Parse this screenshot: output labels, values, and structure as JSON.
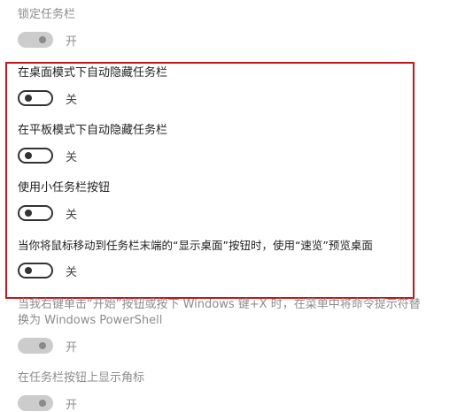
{
  "settings": [
    {
      "label": "锁定任务栏",
      "state": "开"
    },
    {
      "label": "在桌面模式下自动隐藏任务栏",
      "state": "关"
    },
    {
      "label": "在平板模式下自动隐藏任务栏",
      "state": "关"
    },
    {
      "label": "使用小任务栏按钮",
      "state": "关"
    },
    {
      "label": "当你将鼠标移动到任务栏末端的“显示桌面”按钮时，使用“速览”预览桌面",
      "state": "关"
    },
    {
      "label": "当我右键单击“开始”按钮或按下 Windows 键+X 时，在菜单中将命令提示符替换为 Windows PowerShell",
      "state": "开"
    },
    {
      "label": "在任务栏按钮上显示角标",
      "state": "开"
    }
  ],
  "highlight_color": "#c4161c"
}
